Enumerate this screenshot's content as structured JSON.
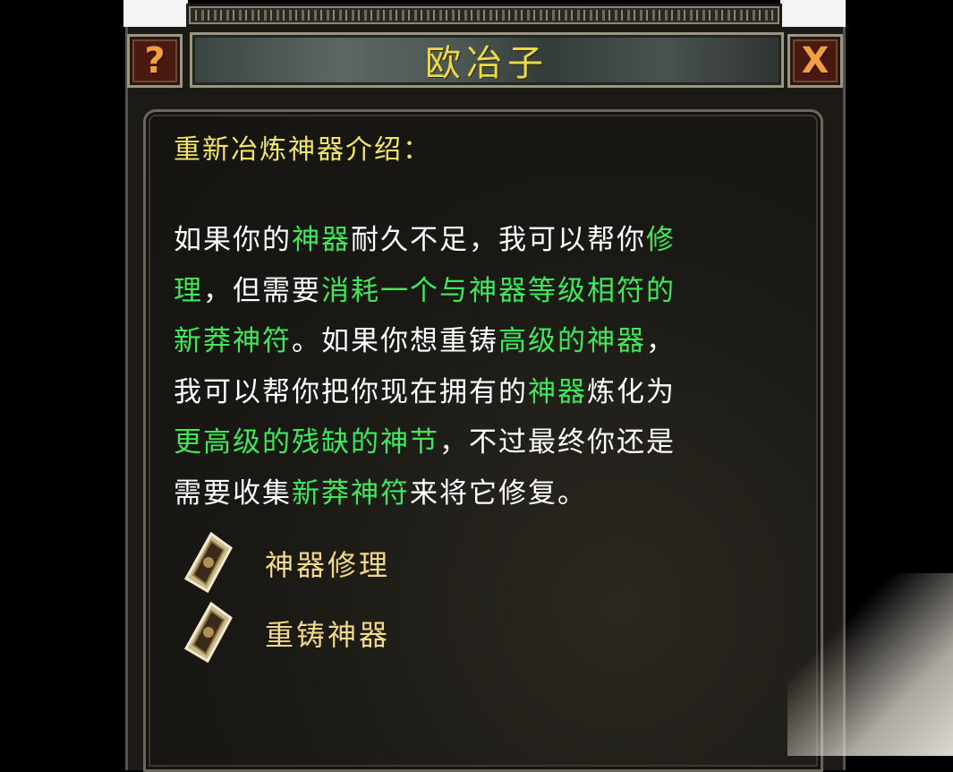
{
  "window": {
    "title": "欧冶子",
    "help_label": "?",
    "close_label": "X"
  },
  "content": {
    "heading": "重新冶炼神器介绍：",
    "paragraph_lines": [
      [
        {
          "t": "如果你的",
          "g": false
        },
        {
          "t": "神器",
          "g": true
        },
        {
          "t": "耐久不足，我可以帮你",
          "g": false
        },
        {
          "t": "修",
          "g": true
        }
      ],
      [
        {
          "t": "理",
          "g": true
        },
        {
          "t": "，但需要",
          "g": false
        },
        {
          "t": "消耗一个与神器等级相符的",
          "g": true
        }
      ],
      [
        {
          "t": "新莽神符",
          "g": true
        },
        {
          "t": "。如果你想重铸",
          "g": false
        },
        {
          "t": "高级的神器",
          "g": true
        },
        {
          "t": "，",
          "g": false
        }
      ],
      [
        {
          "t": "我可以帮你把你现在拥有的",
          "g": false
        },
        {
          "t": "神器",
          "g": true
        },
        {
          "t": "炼化为",
          "g": false
        }
      ],
      [
        {
          "t": "更高级的残缺的神节",
          "g": true
        },
        {
          "t": "，不过最终你还是",
          "g": false
        }
      ],
      [
        {
          "t": "需要收集",
          "g": false
        },
        {
          "t": "新莽神符",
          "g": true
        },
        {
          "t": "来将它修复。",
          "g": false
        }
      ]
    ]
  },
  "options": [
    {
      "label": "神器修理",
      "icon": "gem-icon"
    },
    {
      "label": "重铸神器",
      "icon": "gem-icon"
    }
  ],
  "colors": {
    "heading": "#f2e66a",
    "body_text": "#ffffff",
    "highlight": "#3fe85a",
    "option_text": "#f2d98a",
    "title": "#e8d84a"
  }
}
